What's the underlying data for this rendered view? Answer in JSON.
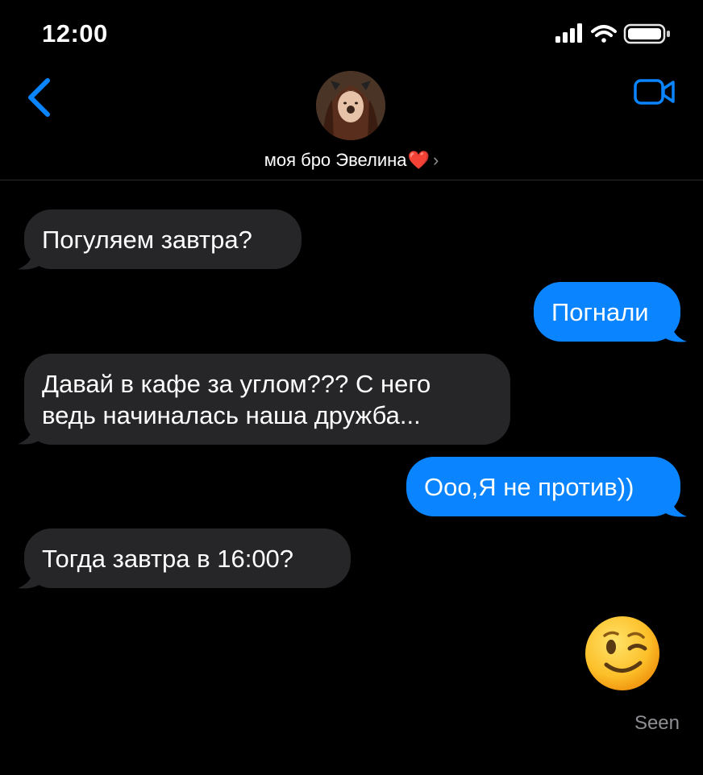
{
  "status_bar": {
    "time": "12:00",
    "icons": [
      "signal-icon",
      "wifi-icon",
      "battery-icon"
    ]
  },
  "header": {
    "contact_name": "моя бро Эвелина",
    "heart_emoji": "❤️",
    "chevron": "›",
    "back_icon": "chevron-left-icon",
    "video_icon": "video-camera-icon"
  },
  "messages": [
    {
      "direction": "incoming",
      "text": "Погуляем завтра?"
    },
    {
      "direction": "outgoing",
      "text": "Погнали"
    },
    {
      "direction": "incoming",
      "lines": [
        "Давай в кафе за углом??? С него",
        "ведь начиналась наша дружба..."
      ]
    },
    {
      "direction": "outgoing",
      "text": "Ооо,Я не против))"
    },
    {
      "direction": "incoming",
      "text": "Тогда завтра в 16:00?"
    },
    {
      "direction": "outgoing",
      "emoji": "winking-face"
    }
  ],
  "receipt": "Seen",
  "colors": {
    "background": "#000000",
    "outgoing_bubble": "#0A84FF",
    "incoming_bubble": "#262629",
    "accent": "#0A84FF",
    "muted_text": "#8E8E93"
  }
}
